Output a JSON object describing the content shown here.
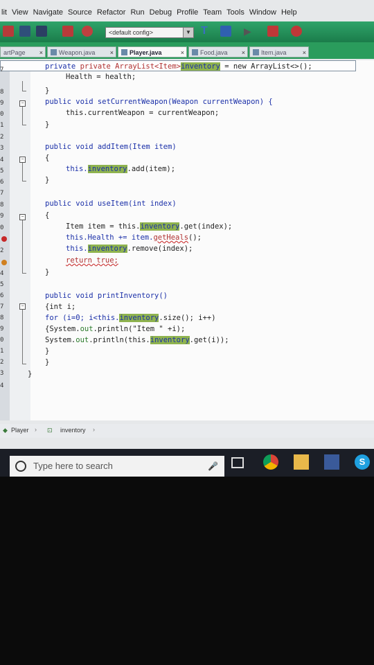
{
  "menu": [
    "lit",
    "View",
    "Navigate",
    "Source",
    "Refactor",
    "Run",
    "Debug",
    "Profile",
    "Team",
    "Tools",
    "Window",
    "Help"
  ],
  "toolbar": {
    "config": "<default config>"
  },
  "tabs": [
    {
      "label": "artPage",
      "active": false
    },
    {
      "label": "Weapon.java",
      "active": false
    },
    {
      "label": "Player.java",
      "active": true
    },
    {
      "label": "Food.java",
      "active": false
    },
    {
      "label": "Item.java",
      "active": false
    }
  ],
  "lines": [
    "7",
    "8",
    "9",
    "0",
    "1",
    "2",
    "3",
    "4",
    "5",
    "6",
    "7",
    "8",
    "9",
    "0",
    "1",
    "2",
    "3",
    "4",
    "5",
    "6",
    "7",
    "8",
    "9",
    "0",
    "1",
    "2",
    "3",
    "4"
  ],
  "code": {
    "l1_a": "private ArrayList<Item>",
    "l1_hl": "inventory",
    "l1_b": " = new ArrayList<>();",
    "l2": "Health = health;",
    "brace": "}",
    "open": "{",
    "m1": "public void setCurrentWeapon(Weapon currentWeapon) {",
    "m1_body": "this.currentWeapon = currentWeapon;",
    "m2": "public void addItem(Item item)",
    "m2_a": "this.",
    "m2_hl": "inventory",
    "m2_b": ".add(item);",
    "m3": "public void useItem(int index)",
    "m3_l1a": "Item item = this.",
    "m3_l1hl": "inventory",
    "m3_l1b": ".get(index);",
    "m3_l2a": "this.Health += item.",
    "m3_l2b": "getHeals",
    "m3_l2c": "();",
    "m3_l3a": "this.",
    "m3_l3hl": "inventory",
    "m3_l3b": ".remove(index);",
    "m3_l4": "return true;",
    "m4": "public void printInventory()",
    "m4_l1": "{int i;",
    "m4_l2a": "for (i=0; i<this.",
    "m4_l2hl": "inventory",
    "m4_l2b": ".size(); i++)",
    "m4_l3a": "{System.",
    "m4_l3out": "out",
    "m4_l3b": ".println(\"Item \" +i);",
    "m4_l4a": "System.",
    "m4_l4out": "out",
    "m4_l4b": ".println(this.",
    "m4_l4hl": "inventory",
    "m4_l4c": ".get(i));"
  },
  "breadcrumbs": {
    "class": "Player",
    "member": "inventory"
  },
  "taskbar": {
    "search_placeholder": "Type here to search"
  }
}
